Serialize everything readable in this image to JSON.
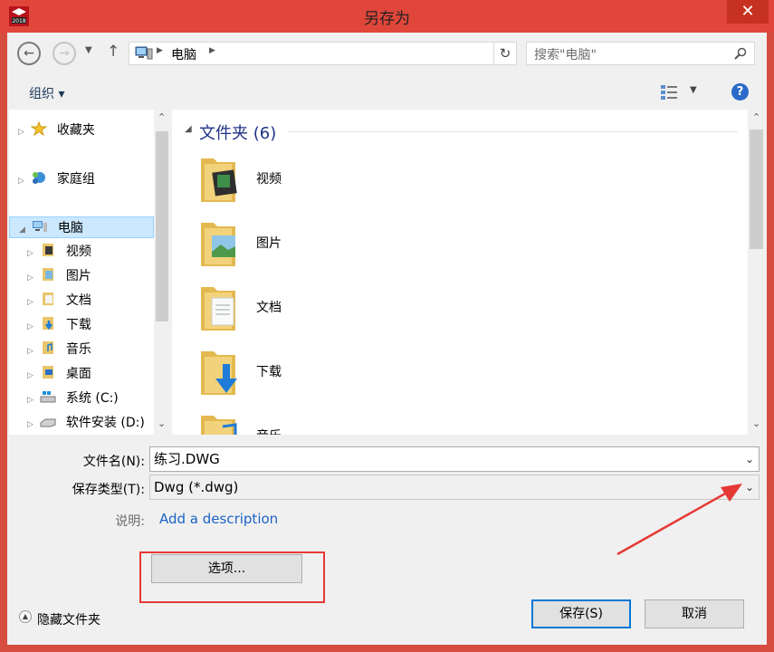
{
  "window": {
    "title": "另存为",
    "app_icon": "solidworks-2018-icon",
    "close_glyph": "✕"
  },
  "nav": {
    "back_icon": "back-arrow-icon",
    "forward_icon": "forward-arrow-icon",
    "recent_icon": "chevron-down-icon",
    "up_icon": "up-arrow-icon",
    "breadcrumb": [
      "电脑"
    ],
    "search_placeholder": "搜索\"电脑\""
  },
  "toolbar": {
    "organize_label": "组织 ▾",
    "help_glyph": "?"
  },
  "sidebar": {
    "items": [
      {
        "label": "收藏夹",
        "icon": "star-icon",
        "level": 0
      },
      {
        "label": "家庭组",
        "icon": "homegroup-icon",
        "level": 0
      },
      {
        "label": "电脑",
        "icon": "computer-icon",
        "level": 0,
        "selected": true,
        "expanded": true
      },
      {
        "label": "视频",
        "icon": "videos-folder-icon",
        "level": 1
      },
      {
        "label": "图片",
        "icon": "pictures-folder-icon",
        "level": 1
      },
      {
        "label": "文档",
        "icon": "documents-folder-icon",
        "level": 1
      },
      {
        "label": "下载",
        "icon": "downloads-folder-icon",
        "level": 1
      },
      {
        "label": "音乐",
        "icon": "music-folder-icon",
        "level": 1
      },
      {
        "label": "桌面",
        "icon": "desktop-folder-icon",
        "level": 1
      },
      {
        "label": "系统 (C:)",
        "icon": "system-drive-icon",
        "level": 1
      },
      {
        "label": "软件安装 (D:)",
        "icon": "drive-icon",
        "level": 1
      }
    ]
  },
  "content": {
    "group_header": "文件夹 (6)",
    "folders": [
      {
        "label": "视频",
        "icon": "videos-folder-icon"
      },
      {
        "label": "图片",
        "icon": "pictures-folder-icon"
      },
      {
        "label": "文档",
        "icon": "documents-folder-icon"
      },
      {
        "label": "下载",
        "icon": "downloads-folder-icon"
      },
      {
        "label": "音乐",
        "icon": "music-folder-icon"
      }
    ]
  },
  "form": {
    "filename_label": "文件名(N):",
    "filename_value": "练习.DWG",
    "filetype_label": "保存类型(T):",
    "filetype_value": "Dwg (*.dwg)",
    "description_label": "说明:",
    "description_link": "Add a description",
    "options_button": "选项...",
    "hide_folders_label": "隐藏文件夹",
    "save_button": "保存(S)",
    "cancel_button": "取消"
  },
  "annotation_colors": {
    "highlight": "#e53935"
  }
}
